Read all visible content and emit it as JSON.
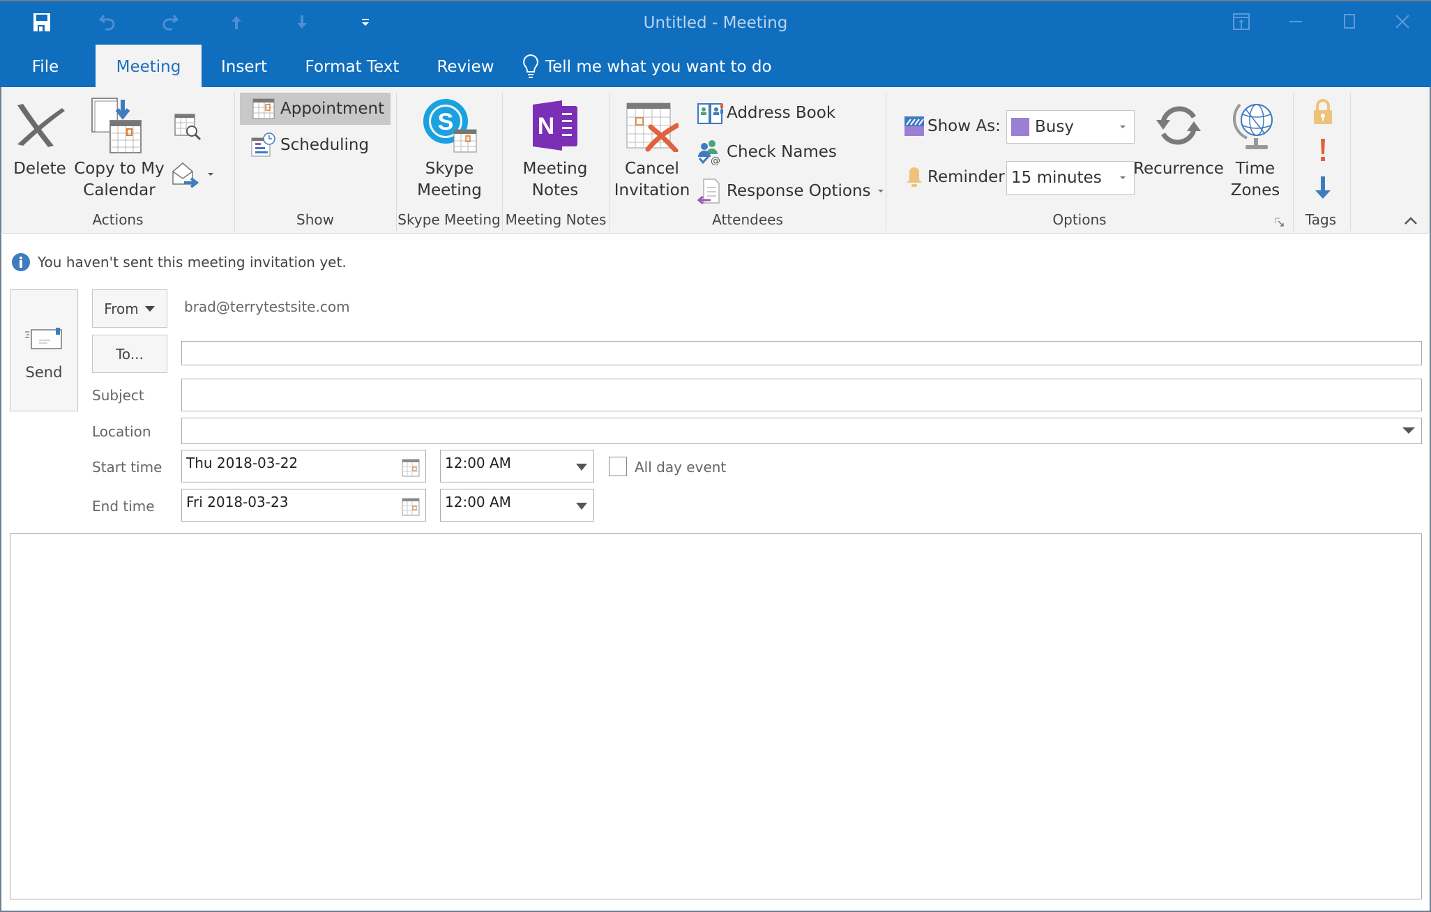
{
  "window": {
    "title": "Untitled  -  Meeting"
  },
  "qat": {
    "save": "save-icon",
    "undo": "undo-icon",
    "redo": "redo-icon",
    "previous": "up-arrow-icon",
    "next": "down-arrow-icon",
    "customize": "customize-qat-icon"
  },
  "tabs": [
    {
      "label": "File",
      "active": false
    },
    {
      "label": "Meeting",
      "active": true
    },
    {
      "label": "Insert",
      "active": false
    },
    {
      "label": "Format Text",
      "active": false
    },
    {
      "label": "Review",
      "active": false
    }
  ],
  "tell_me": "Tell me what you want to do",
  "ribbon": {
    "actions": {
      "label": "Actions",
      "delete": "Delete",
      "copy_line1": "Copy to My",
      "copy_line2": "Calendar"
    },
    "show": {
      "label": "Show",
      "appointment": "Appointment",
      "scheduling": "Scheduling"
    },
    "skype": {
      "label": "Skype Meeting",
      "btn_line1": "Skype",
      "btn_line2": "Meeting"
    },
    "notes": {
      "label": "Meeting Notes",
      "btn_line1": "Meeting",
      "btn_line2": "Notes"
    },
    "attendees": {
      "label": "Attendees",
      "cancel_line1": "Cancel",
      "cancel_line2": "Invitation",
      "address_book": "Address Book",
      "check_names": "Check Names",
      "response_options": "Response Options"
    },
    "options": {
      "label": "Options",
      "show_as_label": "Show As:",
      "show_as_value": "Busy",
      "show_as_color": "#9b7fd4",
      "reminder_label": "Reminder:",
      "reminder_value": "15 minutes",
      "recurrence": "Recurrence",
      "tz_line1": "Time",
      "tz_line2": "Zones"
    },
    "tags": {
      "label": "Tags"
    }
  },
  "info_bar": "You haven't sent this meeting invitation yet.",
  "form": {
    "send": "Send",
    "from_button": "From",
    "from_value": "brad@terrytestsite.com",
    "to_button": "To...",
    "to_value": "",
    "subject_label": "Subject",
    "subject_value": "",
    "location_label": "Location",
    "location_value": "",
    "start_label": "Start time",
    "start_date": "Thu 2018-03-22",
    "start_time": "12:00 AM",
    "all_day_label": "All day event",
    "all_day_checked": false,
    "end_label": "End time",
    "end_date": "Fri 2018-03-23",
    "end_time": "12:00 AM",
    "body": ""
  },
  "colors": {
    "accent": "#106ebe",
    "ribbon_bg": "#f3f3f3",
    "onenote": "#7b2fb5",
    "skype": "#1aa1e2",
    "cancel_x": "#e0623c"
  }
}
